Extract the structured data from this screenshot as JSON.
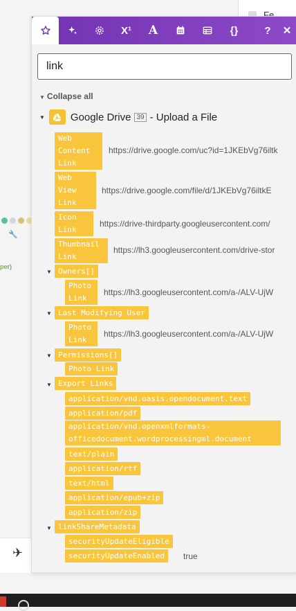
{
  "background": {
    "top_right_text": "Fe",
    "side_text": "per)"
  },
  "toolbar": {
    "icons": [
      "star-icon",
      "sparkle-icon",
      "gear-icon",
      "superscript-icon",
      "text-icon",
      "calendar-icon",
      "table-icon",
      "braces-icon"
    ],
    "superscript_label": "X¹",
    "text_label": "A",
    "braces_label": "{}",
    "help_label": "?",
    "close_label": "✕"
  },
  "search": {
    "value": "link",
    "placeholder": ""
  },
  "collapse_all_label": "Collapse all",
  "module": {
    "name": "Google Drive",
    "number": "39",
    "action": "- Upload a File"
  },
  "fields": {
    "web_content_link": {
      "label": "Web\nContent\nLink",
      "value": "https://drive.google.com/uc?id=1JKEbVg76iltk"
    },
    "web_view_link": {
      "label": "Web\nView\nLink",
      "value": "https://drive.google.com/file/d/1JKEbVg76iltkE"
    },
    "icon_link": {
      "label": "Icon\nLink",
      "value": "https://drive-thirdparty.googleusercontent.com/"
    },
    "thumbnail_link": {
      "label": "Thumbnail\nLink",
      "value": "https://lh3.googleusercontent.com/drive-stor"
    },
    "owners": {
      "label": "Owners[]"
    },
    "owners_photo_link": {
      "label": "Photo\nLink",
      "value": "https://lh3.googleusercontent.com/a-/ALV-UjW"
    },
    "last_modifying_user": {
      "label": "Last Modifying User"
    },
    "lmu_photo_link": {
      "label": "Photo\nLink",
      "value": "https://lh3.googleusercontent.com/a-/ALV-UjW"
    },
    "permissions": {
      "label": "Permissions[]"
    },
    "perm_photo_link": {
      "label": "Photo Link"
    },
    "export_links": {
      "label": "Export Links"
    },
    "export_items": [
      "application/vnd.oasis.opendocument.text",
      "application/pdf",
      "application/vnd.openxmlformats-\nofficedocument.wordprocessingml.document",
      "text/plain",
      "application/rtf",
      "text/html",
      "application/epub+zip",
      "application/zip"
    ],
    "link_share_metadata": {
      "label": "linkShareMetadata"
    },
    "security_update_eligible": {
      "label": "securityUpdateEligible"
    },
    "security_update_enabled": {
      "label": "securityUpdateEnabled",
      "value": "true"
    }
  }
}
